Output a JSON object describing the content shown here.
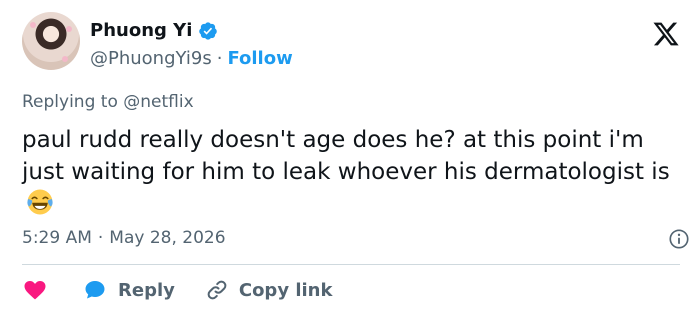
{
  "author": {
    "display_name": "Phuong Yi",
    "handle": "@PhuongYi9s",
    "separator": "·",
    "follow_label": "Follow",
    "verified": true
  },
  "reply_context": {
    "prefix": "Replying to",
    "mention": "@netflix"
  },
  "tweet": {
    "text": "paul rudd really doesn't age does he? at this point i'm just waiting for him to leak whoever his dermatologist is",
    "emoji": "face-with-tears-of-joy"
  },
  "meta": {
    "time": "5:29 AM",
    "separator": "·",
    "date": "May 28, 2026"
  },
  "actions": {
    "like_icon": "heart-icon",
    "reply_label": "Reply",
    "copy_link_label": "Copy link"
  },
  "colors": {
    "accent": "#1d9bf0",
    "like": "#f91880",
    "secondary_text": "#536471",
    "primary_text": "#0f1419",
    "divider": "#cfd9de"
  }
}
